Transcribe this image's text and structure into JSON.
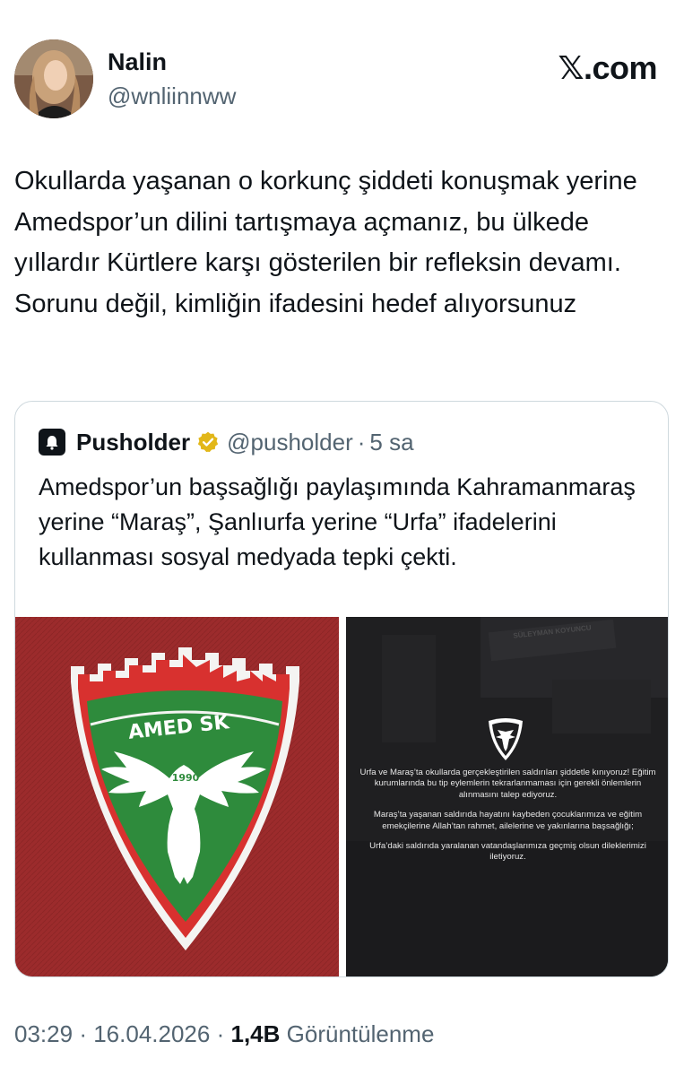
{
  "author": {
    "name": "Nalin",
    "handle": "@wnliinnww"
  },
  "brand": "𝕏.com",
  "tweet": {
    "text": "Okullarda yaşanan o korkunç şiddeti konuşmak yerine Amedspor’un dilini tartışmaya açmanız, bu ülkede yıllardır Kürtlere karşı gösterilen bir refleksin devamı. Sorunu değil, kimliğin ifadesini hedef alıyorsunuz"
  },
  "quote": {
    "name": "Pusholder",
    "handle": "@pusholder",
    "separator": "·",
    "time": "5 sa",
    "text": "Amedspor’un başsağlığı paylaşımında Kahramanmaraş yerine “Maraş”, Şanlıurfa yerine “Urfa” ifadelerini kullanması sosyal medyada tepki çekti.",
    "crest_text": "AMED SK",
    "crest_year": "1990",
    "statement": [
      "Urfa ve Maraş’ta okullarda gerçekleştirilen saldırıları şiddetle kınıyoruz! Eğitim kurumlarında bu tip eylemlerin tekrarlanmaması için gerekli önlemlerin alınmasını talep ediyoruz.",
      "Maraş’ta yaşanan saldırıda hayatını kaybeden çocuklarımıza ve eğitim emekçilerine Allah’tan rahmet, ailelerine ve yakınlarına başsağlığı;",
      "Urfa’daki saldırıda yaralanan vatandaşlarımıza geçmiş olsun dileklerimizi iletiyoruz."
    ],
    "sign_text": "SÜLEYMAN KOYUNCU"
  },
  "footer": {
    "time": "03:29",
    "sep1": "·",
    "date": "16.04.2026",
    "sep2": "·",
    "views": "1,4B",
    "views_label": "Görüntülenme"
  },
  "colors": {
    "text_primary": "#0f1419",
    "text_secondary": "#536471",
    "border": "#cfd9de",
    "crest_red": "#9c2b2c",
    "crest_green": "#2e8b3c",
    "verified_gold": "#e2b719"
  },
  "icons": [
    "profile-avatar",
    "verified-badge-icon",
    "pusholder-bell-icon",
    "amed-sk-crest"
  ]
}
